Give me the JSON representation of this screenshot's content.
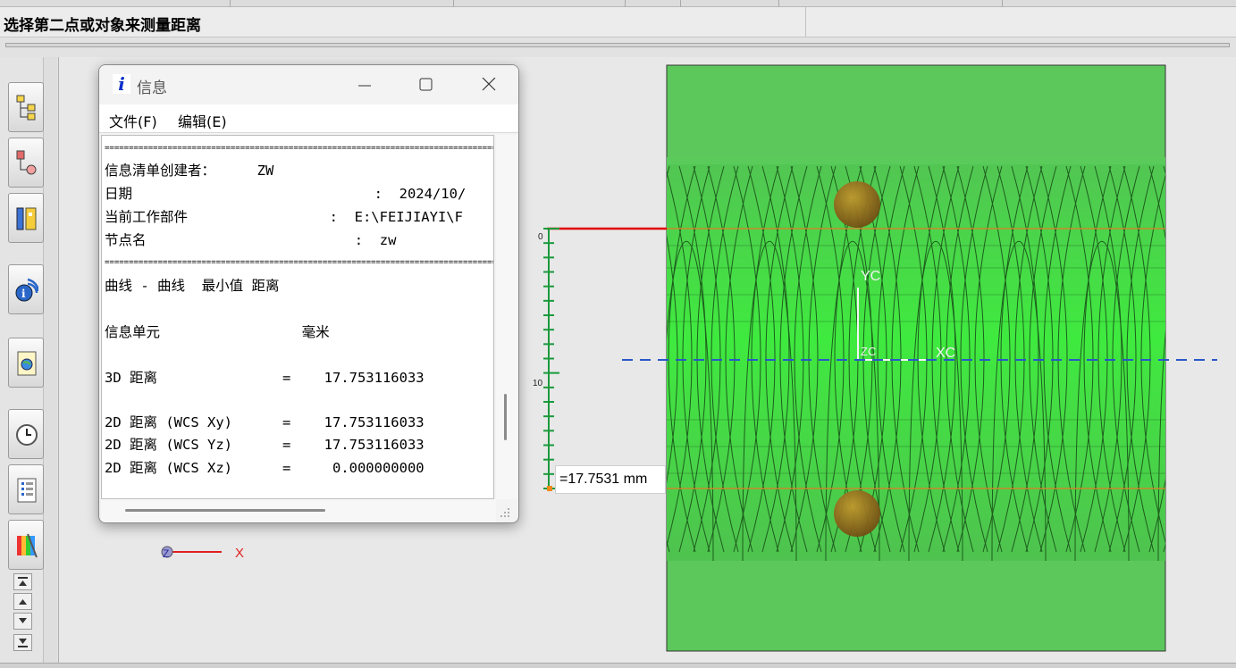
{
  "app": {
    "cue_line": "选择第二点或对象来测量距离"
  },
  "resource_bar": {
    "buttons": [
      {
        "icon": "assembly-navigator-icon"
      },
      {
        "icon": "constraint-navigator-icon"
      },
      {
        "icon": "part-navigator-icon"
      },
      {
        "icon": "reuse-library-icon"
      },
      {
        "icon": "web-browser-icon"
      },
      {
        "icon": "history-icon"
      },
      {
        "icon": "process-studio-icon"
      },
      {
        "icon": "roles-icon"
      }
    ],
    "scroll_buttons": [
      "scroll-top-icon",
      "scroll-up-icon",
      "scroll-down-icon",
      "scroll-bottom-icon"
    ]
  },
  "viewport": {
    "ruler": {
      "label_zero": "0",
      "label_ten": "10"
    },
    "measurement": "=17.7531 mm",
    "wcs": {
      "yc": "YC",
      "xc": "XC",
      "zc": "ZC"
    },
    "absolute_axis": {
      "x": "X",
      "z": "Z"
    },
    "colors": {
      "part_fill": "#55c855",
      "thread_lines": "#1a5e1a",
      "measure_line": "#e00000",
      "center_line": "#2255cc",
      "ruler": "#1a9a3c"
    }
  },
  "info_window": {
    "title": "信息",
    "menu": {
      "file": "文件(F)",
      "edit": "编辑(E)"
    },
    "rule_text": "==========================================================================================",
    "lines": [
      "信息清单创建者：     ZW",
      "日期                             :  2024/10/",
      "当前工作部件                 :  E:\\FEIJIAYI\\F",
      "节点名                         :  zw"
    ],
    "section": "曲线 - 曲线  最小值 距离",
    "unit_line": "信息单元                 毫米",
    "distance_3d": "3D 距离               =    17.753116033",
    "distance_xy": "2D 距离 (WCS Xy)      =    17.753116033",
    "distance_yz": "2D 距离 (WCS Yz)      =    17.753116033",
    "distance_xz": "2D 距离 (WCS Xz)      =     0.000000000"
  }
}
